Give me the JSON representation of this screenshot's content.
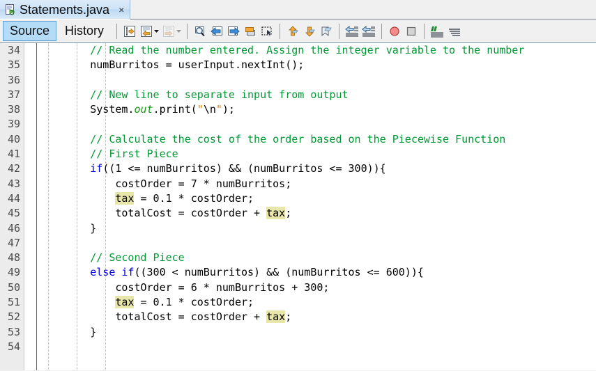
{
  "window": {
    "tab": {
      "title": "Statements.java",
      "close_label": "×",
      "icon": "java-file-icon"
    }
  },
  "toolbar": {
    "modes": [
      {
        "label": "Source",
        "selected": true
      },
      {
        "label": "History",
        "selected": false
      }
    ],
    "buttons": [
      {
        "name": "last-edit-icon"
      },
      {
        "name": "back-navigation-icon"
      },
      {
        "name": "back-dropdown-icon"
      },
      {
        "name": "forward-navigation-icon"
      },
      {
        "name": "forward-dropdown-icon"
      },
      {
        "name": "find-selection-icon"
      },
      {
        "name": "find-previous-icon"
      },
      {
        "name": "find-next-icon"
      },
      {
        "name": "toggle-highlight-icon"
      },
      {
        "name": "toggle-rectangular-selection-icon"
      },
      {
        "name": "previous-bookmark-icon"
      },
      {
        "name": "next-bookmark-icon"
      },
      {
        "name": "toggle-bookmark-icon"
      },
      {
        "name": "shift-line-left-icon"
      },
      {
        "name": "shift-line-right-icon"
      },
      {
        "name": "start-macro-recording-icon"
      },
      {
        "name": "stop-macro-recording-icon"
      },
      {
        "name": "comment-icon"
      },
      {
        "name": "uncomment-icon"
      }
    ]
  },
  "editor": {
    "first_line": 34,
    "line_numbers": [
      34,
      35,
      36,
      37,
      38,
      39,
      40,
      41,
      42,
      43,
      44,
      45,
      46,
      47,
      48,
      49,
      50,
      51,
      52,
      53,
      54
    ],
    "highlight_color": "#e8e6a8",
    "highlighted_word": "tax",
    "lines": [
      {
        "n": 34,
        "text": "        // Read the number entered. Assign the integer variable to the number"
      },
      {
        "n": 35,
        "text": "        numBurritos = userInput.nextInt();"
      },
      {
        "n": 36,
        "text": ""
      },
      {
        "n": 37,
        "text": "        // New line to separate input from output"
      },
      {
        "n": 38,
        "text": "        System.out.print(\"\\n\");"
      },
      {
        "n": 39,
        "text": ""
      },
      {
        "n": 40,
        "text": "        // Calculate the cost of the order based on the Piecewise Function"
      },
      {
        "n": 41,
        "text": "        // First Piece"
      },
      {
        "n": 42,
        "text": "        if((1 <= numBurritos) && (numBurritos <= 300)){"
      },
      {
        "n": 43,
        "text": "            costOrder = 7 * numBurritos;"
      },
      {
        "n": 44,
        "text": "            tax = 0.1 * costOrder;"
      },
      {
        "n": 45,
        "text": "            totalCost = costOrder + tax;"
      },
      {
        "n": 46,
        "text": "        }"
      },
      {
        "n": 47,
        "text": ""
      },
      {
        "n": 48,
        "text": "        // Second Piece"
      },
      {
        "n": 49,
        "text": "        else if((300 < numBurritos) && (numBurritos <= 600)){"
      },
      {
        "n": 50,
        "text": "            costOrder = 6 * numBurritos + 300;"
      },
      {
        "n": 51,
        "text": "            tax = 0.1 * costOrder;"
      },
      {
        "n": 52,
        "text": "            totalCost = costOrder + tax;"
      },
      {
        "n": 53,
        "text": "        }"
      },
      {
        "n": 54,
        "text": ""
      }
    ]
  },
  "colors": {
    "comment": "#009933",
    "keyword": "#0000e6",
    "field": "#0f9b0f",
    "string": "#e08000",
    "escape": "#d40000",
    "gutter_bg": "#ececec",
    "tab_selected_bg": "#b5dcf7"
  }
}
